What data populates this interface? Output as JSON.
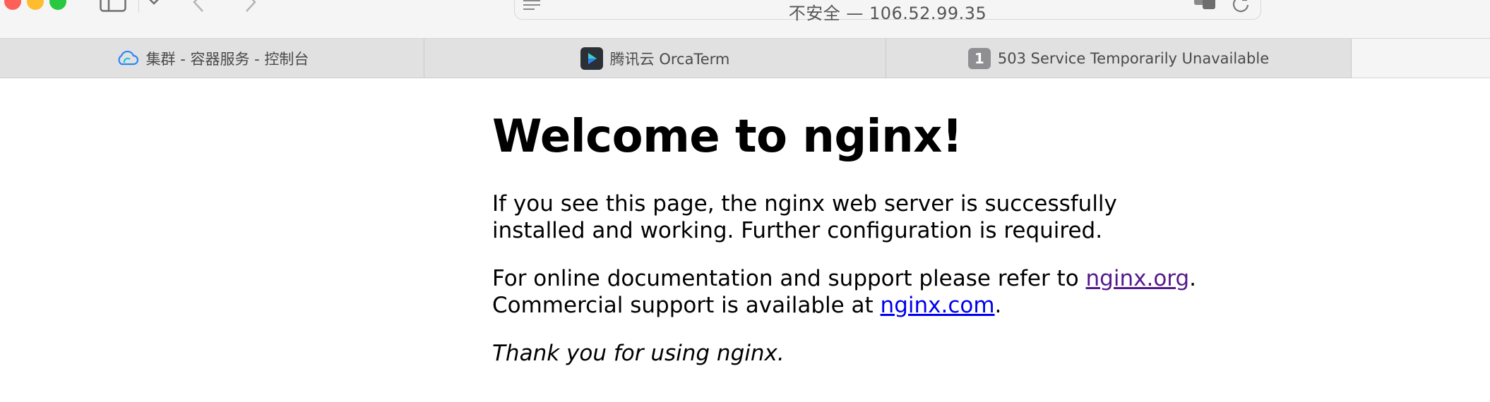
{
  "address_bar": {
    "text": "不安全 — 106.52.99.35"
  },
  "tabs": [
    {
      "label": "集群 - 容器服务 - 控制台",
      "icon": "cloud-icon"
    },
    {
      "label": "腾讯云 OrcaTerm",
      "icon": "orcaterm-icon"
    },
    {
      "label": "503 Service Temporarily Unavailable",
      "icon": "badge-icon",
      "badge": "1"
    }
  ],
  "page": {
    "heading": "Welcome to nginx!",
    "para1": "If you see this page, the nginx web server is successfully installed and working. Further configuration is required.",
    "para2_prefix": "For online documentation and support please refer to ",
    "link_org": "nginx.org",
    "para2_mid": ".",
    "para2_line2": "Commercial support is available at ",
    "link_com": "nginx.com",
    "para2_end": ".",
    "thanks": "Thank you for using nginx."
  },
  "colors": {
    "visited_link": "#551a8b",
    "link": "#0000ee",
    "tab_bg": "#e2e1e1"
  }
}
